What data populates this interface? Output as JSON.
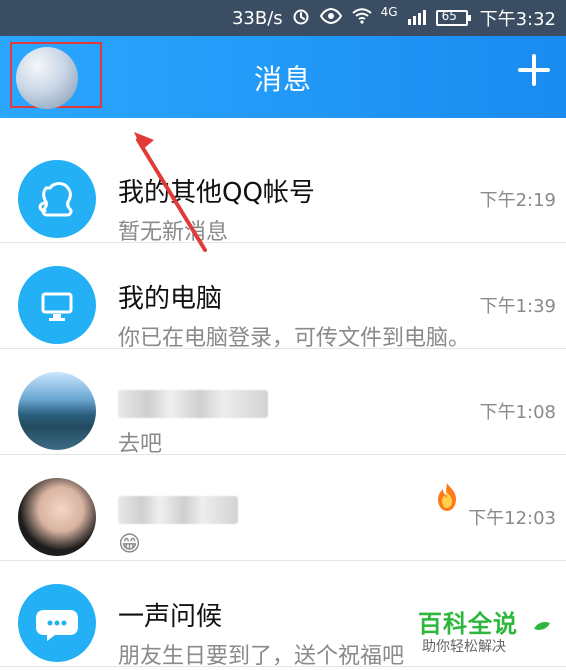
{
  "status_bar": {
    "speed": "33B/s",
    "network": "4G",
    "battery": "65",
    "time": "下午3:32",
    "icons": [
      "alarm-icon",
      "eye-icon",
      "wifi-icon",
      "signal-icon",
      "battery-icon"
    ]
  },
  "app_bar": {
    "title": "消息",
    "left_avatar_icon": "profile-avatar",
    "right_icon": "plus-icon"
  },
  "conversations": [
    {
      "name": "我的其他QQ帐号",
      "preview": "暂无新消息",
      "time": "下午2:19",
      "avatar_icon": "qq-accounts-icon"
    },
    {
      "name": "我的电脑",
      "preview": "你已在电脑登录，可传文件到电脑。",
      "time": "下午1:39",
      "avatar_icon": "computer-icon"
    },
    {
      "name": "",
      "preview": "去吧",
      "time": "下午1:08",
      "avatar_icon": "landscape-avatar"
    },
    {
      "name": "",
      "preview": "😁",
      "time": "下午12:03",
      "avatar_icon": "girl-avatar",
      "badge_icon": "flame-icon"
    },
    {
      "name": "一声问候",
      "preview": "朋友生日要到了，送个祝福吧",
      "time": "",
      "avatar_icon": "chat-bubble-icon"
    }
  ],
  "watermark": {
    "title": "百科全说",
    "subtitle": "助你轻松解决"
  },
  "colors": {
    "status_bar_bg": "#3a4d63",
    "app_bar_bg": "#2aa7ff",
    "accent_blue": "#23b0f5",
    "highlight_red": "#e23a3a",
    "watermark_green": "#2db83d"
  }
}
